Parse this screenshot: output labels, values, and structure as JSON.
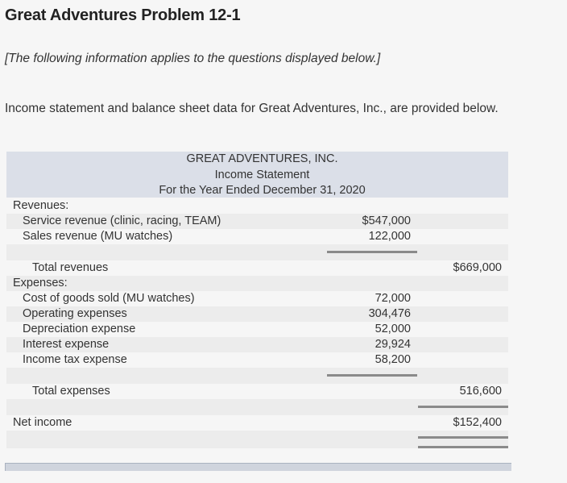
{
  "page": {
    "title": "Great Adventures Problem 12-1",
    "note": "[The following information applies to the questions displayed below.]",
    "intro": "Income statement and balance sheet data for Great Adventures, Inc., are provided below."
  },
  "statement": {
    "company": "GREAT ADVENTURES, INC.",
    "name": "Income Statement",
    "period": "For the Year Ended December 31, 2020",
    "revenues_label": "Revenues:",
    "revenue_items": [
      {
        "label": "Service revenue (clinic, racing, TEAM)",
        "amount": "$547,000"
      },
      {
        "label": "Sales revenue (MU watches)",
        "amount": "122,000"
      }
    ],
    "total_revenues": {
      "label": "Total revenues",
      "amount": "$669,000"
    },
    "expenses_label": "Expenses:",
    "expense_items": [
      {
        "label": "Cost of goods sold (MU watches)",
        "amount": "72,000"
      },
      {
        "label": "Operating expenses",
        "amount": "304,476"
      },
      {
        "label": "Depreciation expense",
        "amount": "52,000"
      },
      {
        "label": "Interest expense",
        "amount": "29,924"
      },
      {
        "label": "Income tax expense",
        "amount": "58,200"
      }
    ],
    "total_expenses": {
      "label": "Total expenses",
      "amount": "516,600"
    },
    "net_income": {
      "label": "Net income",
      "amount": "$152,400"
    }
  }
}
